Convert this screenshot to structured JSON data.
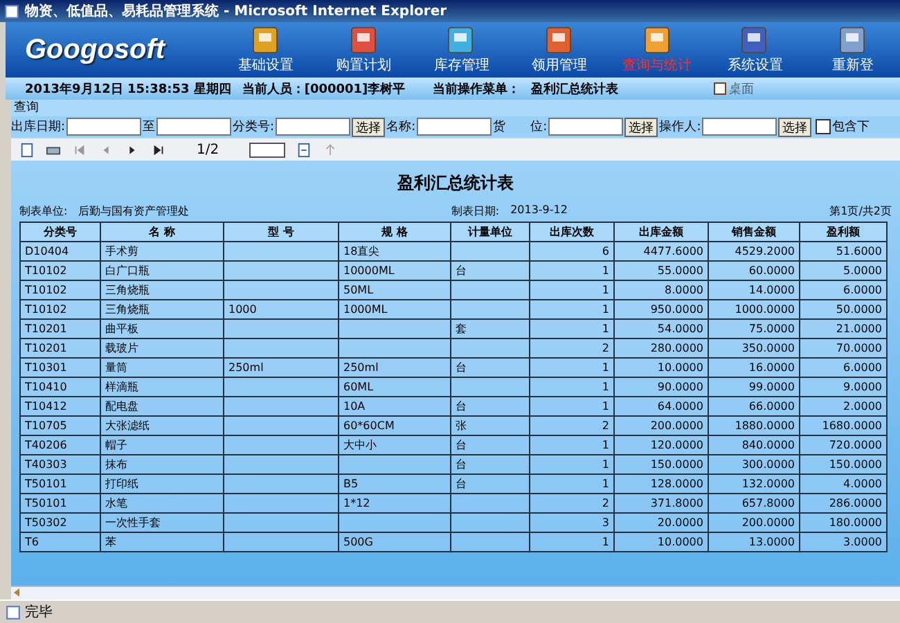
{
  "window": {
    "title": "物资、低值品、易耗品管理系统 - Microsoft Internet Explorer"
  },
  "header": {
    "logo": "Googosoft",
    "nav": [
      {
        "label": "基础设置",
        "selected": false
      },
      {
        "label": "购置计划",
        "selected": false
      },
      {
        "label": "库存管理",
        "selected": false
      },
      {
        "label": "领用管理",
        "selected": false
      },
      {
        "label": "查询与统计",
        "selected": true
      },
      {
        "label": "系统设置",
        "selected": false
      },
      {
        "label": "重新登",
        "selected": false
      }
    ]
  },
  "info_bar": {
    "datetime": "2013年9月12日  15:38:53  星期四",
    "operator": "当前人员：[000001]李树平",
    "menu_label": "当前操作菜单：",
    "menu_value": "盈利汇总统计表",
    "desktop": "桌面"
  },
  "query": {
    "label": "查询",
    "filters": [
      {
        "kind": "field",
        "label": "出库日期:"
      },
      {
        "kind": "field",
        "label": "至"
      },
      {
        "kind": "select",
        "label": "分类号:",
        "button": "选择"
      },
      {
        "kind": "field",
        "label": "名称:"
      },
      {
        "kind": "select",
        "label": "货　　位:",
        "button": "选择"
      },
      {
        "kind": "select",
        "label": "操作人:",
        "button": "选择"
      },
      {
        "kind": "check",
        "label": "包含下",
        "checked": false
      }
    ]
  },
  "toolbar": {
    "page": "1/2"
  },
  "report": {
    "title": "盈利汇总统计表",
    "unit_label": "制表单位:",
    "unit": "后勤与国有资产管理处",
    "date_label": "制表日期:",
    "date": "2013-9-12",
    "page": "第1页/共2页",
    "columns": [
      "分类号",
      "名 称",
      "型 号",
      "规 格",
      "计量单位",
      "出库次数",
      "出库金额",
      "销售金额",
      "盈利额"
    ],
    "rows": [
      [
        "D10404",
        "手术剪",
        "",
        "18直尖",
        "",
        "6",
        "4477.6000",
        "4529.2000",
        "51.6000"
      ],
      [
        "T10102",
        "白广口瓶",
        "",
        "10000ML",
        "台",
        "1",
        "55.0000",
        "60.0000",
        "5.0000"
      ],
      [
        "T10102",
        "三角烧瓶",
        "",
        "50ML",
        "",
        "1",
        "8.0000",
        "14.0000",
        "6.0000"
      ],
      [
        "T10102",
        "三角烧瓶",
        "1000",
        "1000ML",
        "",
        "1",
        "950.0000",
        "1000.0000",
        "50.0000"
      ],
      [
        "T10201",
        "曲平板",
        "",
        "",
        "套",
        "1",
        "54.0000",
        "75.0000",
        "21.0000"
      ],
      [
        "T10201",
        "载玻片",
        "",
        "",
        "",
        "2",
        "280.0000",
        "350.0000",
        "70.0000"
      ],
      [
        "T10301",
        "量筒",
        "250ml",
        "250ml",
        "台",
        "1",
        "10.0000",
        "16.0000",
        "6.0000"
      ],
      [
        "T10410",
        "样滴瓶",
        "",
        "60ML",
        "",
        "1",
        "90.0000",
        "99.0000",
        "9.0000"
      ],
      [
        "T10412",
        "配电盘",
        "",
        "10A",
        "台",
        "1",
        "64.0000",
        "66.0000",
        "2.0000"
      ],
      [
        "T10705",
        "大张滤纸",
        "",
        "60*60CM",
        "张",
        "2",
        "200.0000",
        "1880.0000",
        "1680.0000"
      ],
      [
        "T40206",
        "帽子",
        "",
        "大中小",
        "台",
        "1",
        "120.0000",
        "840.0000",
        "720.0000"
      ],
      [
        "T40303",
        "抹布",
        "",
        "",
        "台",
        "1",
        "150.0000",
        "300.0000",
        "150.0000"
      ],
      [
        "T50101",
        "打印纸",
        "",
        "B5",
        "台",
        "1",
        "128.0000",
        "132.0000",
        "4.0000"
      ],
      [
        "T50101",
        "水笔",
        "",
        "1*12",
        "",
        "2",
        "371.8000",
        "657.8000",
        "286.0000"
      ],
      [
        "T50302",
        "一次性手套",
        "",
        "",
        "",
        "3",
        "20.0000",
        "200.0000",
        "180.0000"
      ],
      [
        "T6",
        "苯",
        "",
        "500G",
        "",
        "1",
        "10.0000",
        "13.0000",
        "3.0000"
      ]
    ]
  },
  "status_bar": {
    "text": "完毕"
  }
}
